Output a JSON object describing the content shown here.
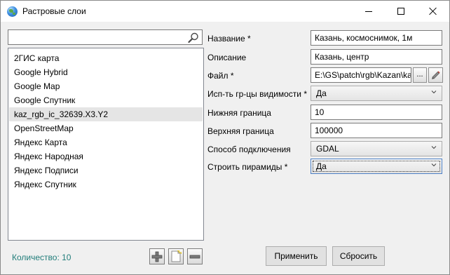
{
  "window": {
    "title": "Растровые слои"
  },
  "search": {
    "value": "",
    "placeholder": ""
  },
  "layers": {
    "items": [
      {
        "label": "2ГИС карта"
      },
      {
        "label": "Google Hybrid"
      },
      {
        "label": "Google Map"
      },
      {
        "label": "Google Спутник"
      },
      {
        "label": "kaz_rgb_ic_32639.X3.Y2",
        "selected": true
      },
      {
        "label": "OpenStreetMap"
      },
      {
        "label": "Яндекс Карта"
      },
      {
        "label": "Яндекс Народная"
      },
      {
        "label": "Яндекс Подписи"
      },
      {
        "label": "Яндекс Спутник"
      }
    ],
    "count_label": "Количество: 10"
  },
  "form": {
    "name_label": "Название *",
    "name_value": "Казань, космоснимок, 1м",
    "description_label": "Описание",
    "description_value": "Казань, центр",
    "file_label": "Файл *",
    "file_value": "E:\\GS\\patch\\rgb\\Kazan\\ka",
    "browse_label": "...",
    "visibility_label": "Исп-ть гр-цы видимости *",
    "visibility_value": "Да",
    "lower_label": "Нижняя граница",
    "lower_value": "10",
    "upper_label": "Верхняя граница",
    "upper_value": "100000",
    "connection_label": "Способ подключения",
    "connection_value": "GDAL",
    "pyramids_label": "Строить пирамиды *",
    "pyramids_value": "Да"
  },
  "buttons": {
    "apply": "Применить",
    "reset": "Сбросить"
  },
  "colors": {
    "count_text": "#217d7a",
    "selection": "#e5e5e5",
    "focus_border": "#4d80c5"
  }
}
